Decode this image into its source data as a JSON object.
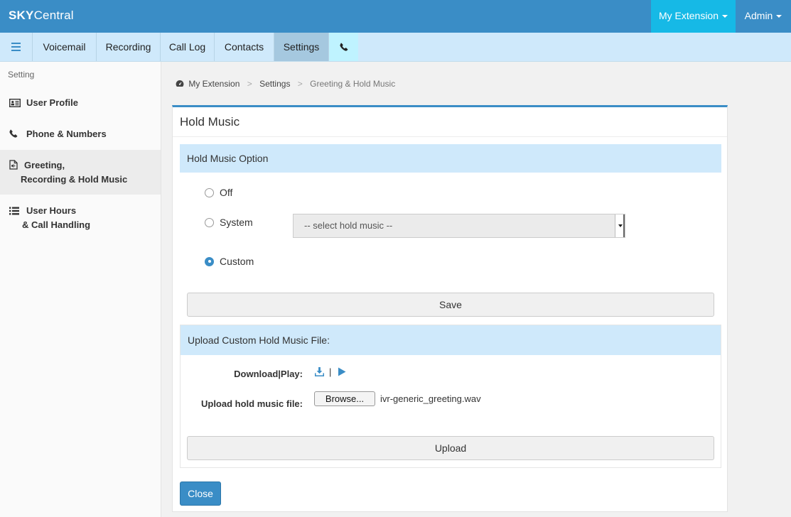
{
  "app": {
    "brand_bold": "SKY",
    "brand_rest": "Central"
  },
  "topnav": {
    "my_extension": "My Extension",
    "admin": "Admin"
  },
  "tabs": [
    {
      "label": "Voicemail"
    },
    {
      "label": "Recording"
    },
    {
      "label": "Call Log"
    },
    {
      "label": "Contacts"
    },
    {
      "label": "Settings",
      "active": true
    }
  ],
  "sidebar": {
    "heading": "Setting",
    "items": [
      {
        "line1": "User Profile",
        "line2": ""
      },
      {
        "line1": "Phone & Numbers",
        "line2": ""
      },
      {
        "line1": "Greeting,",
        "line2": "Recording & Hold Music",
        "active": true
      },
      {
        "line1": "User Hours",
        "line2": "& Call Handling"
      }
    ]
  },
  "breadcrumb": {
    "item1": "My Extension",
    "item2": "Settings",
    "item3": "Greeting & Hold Music"
  },
  "panel": {
    "title": "Hold Music",
    "option_section": "Hold Music Option",
    "options": [
      {
        "label": "Off",
        "checked": false
      },
      {
        "label": "System",
        "checked": false
      },
      {
        "label": "Custom",
        "checked": true
      }
    ],
    "select_placeholder": "-- select hold music --",
    "save_label": "Save",
    "upload_section": "Upload Custom Hold Music File:",
    "download_label": "Download|Play:",
    "download_separator": "|",
    "upload_label": "Upload hold music file:",
    "browse_label": "Browse...",
    "file_name": "ivr-generic_greeting.wav",
    "upload_label_button": "Upload",
    "close_label": "Close"
  },
  "colors": {
    "primary": "#3a8dc6",
    "accent": "#16b9e6",
    "tabbar": "#cfe9fb",
    "section": "#cfe9fb"
  }
}
